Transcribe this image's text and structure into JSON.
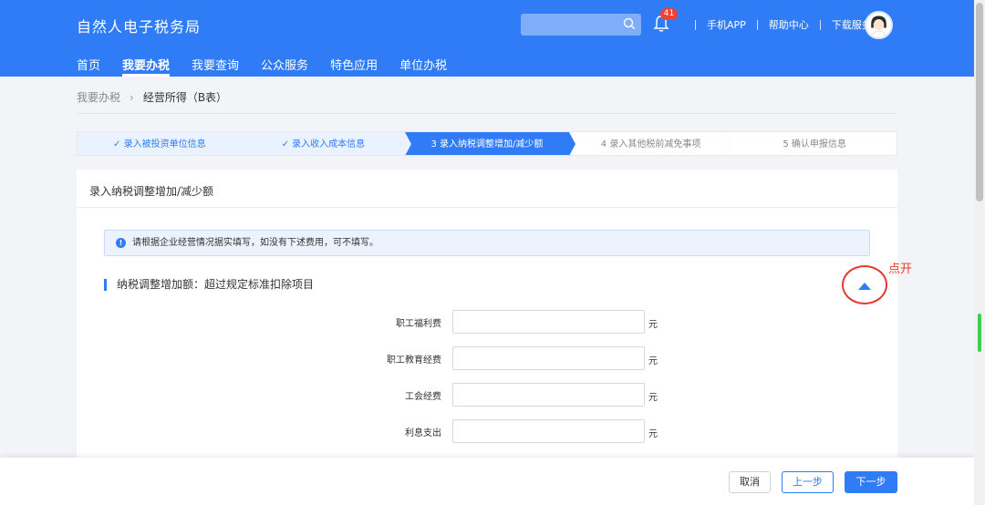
{
  "header": {
    "site_title": "自然人电子税务局",
    "notification_count": "41",
    "links": [
      "手机APP",
      "帮助中心",
      "下载服务"
    ],
    "nav": [
      {
        "label": "首页",
        "active": false
      },
      {
        "label": "我要办税",
        "active": true
      },
      {
        "label": "我要查询",
        "active": false
      },
      {
        "label": "公众服务",
        "active": false
      },
      {
        "label": "特色应用",
        "active": false
      },
      {
        "label": "单位办税",
        "active": false
      }
    ]
  },
  "breadcrumb": {
    "parent": "我要办税",
    "current": "经营所得（B表）"
  },
  "steps": [
    {
      "label": "✓ 录入被投资单位信息",
      "state": "done"
    },
    {
      "label": "✓ 录入收入成本信息",
      "state": "done"
    },
    {
      "label": "3  录入纳税调整增加/减少额",
      "state": "active"
    },
    {
      "label": "4  录入其他税前减免事项",
      "state": "pending"
    },
    {
      "label": "5  确认申报信息",
      "state": "pending"
    }
  ],
  "panel": {
    "title": "录入纳税调整增加/减少额",
    "notice": "请根据企业经营情况据实填写，如没有下述费用，可不填写。",
    "section_title": "纳税调整增加额：超过规定标准扣除项目",
    "fields": [
      {
        "label": "职工福利费",
        "value": "",
        "unit": "元"
      },
      {
        "label": "职工教育经费",
        "value": "",
        "unit": "元"
      },
      {
        "label": "工会经费",
        "value": "",
        "unit": "元"
      },
      {
        "label": "利息支出",
        "value": "",
        "unit": "元"
      }
    ]
  },
  "annotation": {
    "text": "点开"
  },
  "footer": {
    "cancel": "取消",
    "prev": "上一步",
    "next": "下一步"
  },
  "colors": {
    "primary": "#2f7cf6",
    "annotation": "#e33b2e"
  }
}
